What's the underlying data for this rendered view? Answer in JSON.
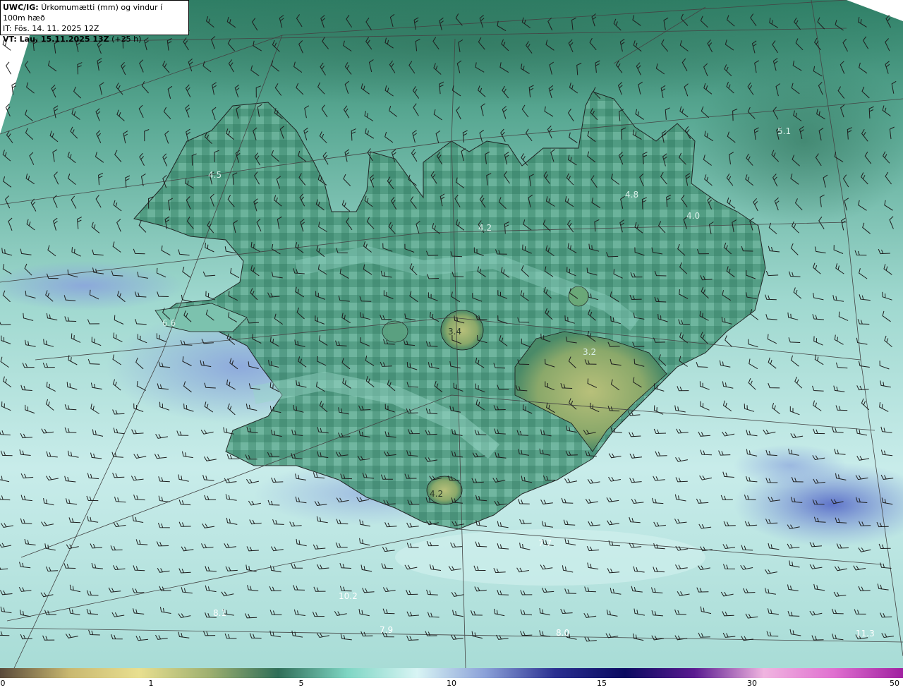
{
  "header": {
    "model": "UWC/IG:",
    "title": "Úrkomumætti (mm) og vindur í 100m hæð",
    "init_time": "IT: Fös. 14. 11. 2025 12Z",
    "valid_prefix": "VT: Lau. 15.11.2025 13Z",
    "valid_suffix": "(+25 h)"
  },
  "map_labels": [
    {
      "text": "6.6",
      "tone": "light"
    },
    {
      "text": "4.5",
      "tone": "light"
    },
    {
      "text": "5.1",
      "tone": "light"
    },
    {
      "text": "4.8",
      "tone": "light"
    },
    {
      "text": "4.0",
      "tone": "light"
    },
    {
      "text": "4.2",
      "tone": "light"
    },
    {
      "text": "3.4",
      "tone": "dark"
    },
    {
      "text": "3.2",
      "tone": "light"
    },
    {
      "text": "4.2",
      "tone": "dark"
    },
    {
      "text": "7.7",
      "tone": "light"
    },
    {
      "text": "10.2",
      "tone": "light"
    },
    {
      "text": "8.1",
      "tone": "light"
    },
    {
      "text": "7.9",
      "tone": "light"
    },
    {
      "text": "8.0",
      "tone": "light"
    },
    {
      "text": "11.3",
      "tone": "light"
    }
  ],
  "colorbar": {
    "ticks": [
      "0",
      "1",
      "5",
      "10",
      "15",
      "30",
      "50"
    ],
    "colors": [
      "#5a4a3a",
      "#c9b870",
      "#e8df90",
      "#9fb070",
      "#2f6e58",
      "#7fd6c4",
      "#d8f4f4",
      "#8aa0d8",
      "#2a2f90",
      "#0a0a60",
      "#5a1a90",
      "#f0b4e0",
      "#e070d0",
      "#a020a0"
    ]
  },
  "palette": {
    "sea_light": "#bfe6e2",
    "sea_mid": "#6fbfb0",
    "sea_dark": "#2f7a62",
    "blue_patch": "#98b6e0",
    "land_dark": "#3a7a5e",
    "ice": "#a9b56e"
  }
}
